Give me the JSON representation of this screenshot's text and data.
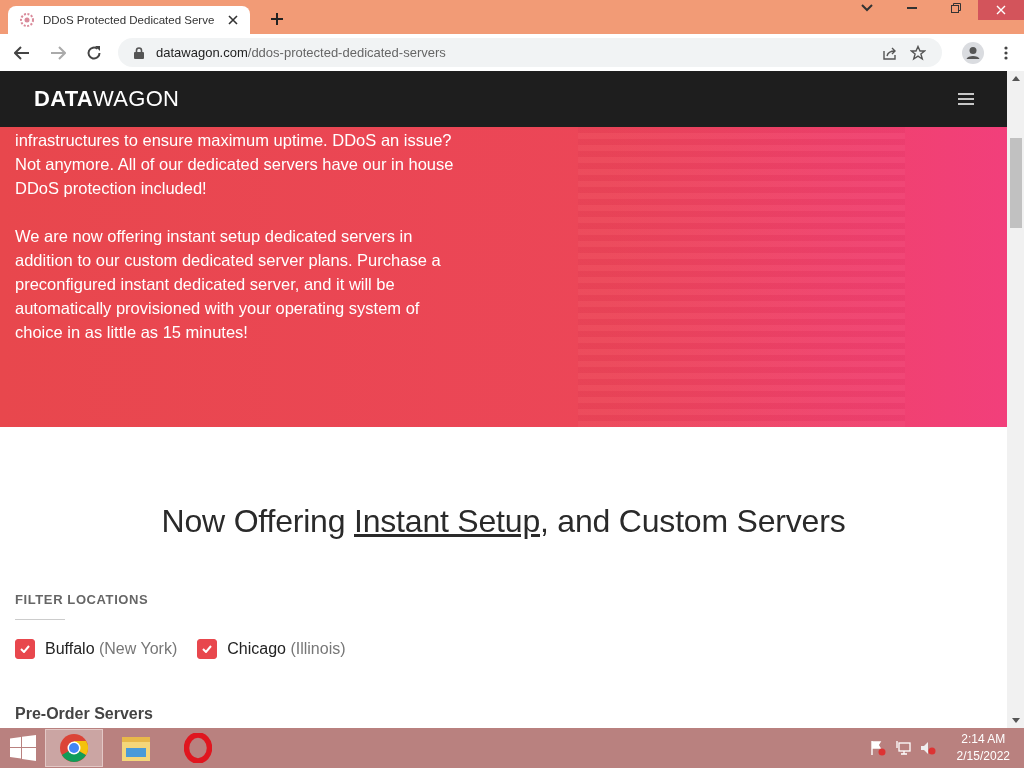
{
  "browser": {
    "tab_title": "DDoS Protected Dedicated Serve",
    "url_host": "datawagon.com",
    "url_path": "/ddos-protected-dedicated-servers"
  },
  "site_nav": {
    "logo_bold": "DATA",
    "logo_light": "WAGON"
  },
  "hero": {
    "paragraphs": [
      "infrastructures to ensure maximum uptime. DDoS an issue? Not anymore. All of our dedicated servers have our in house DDoS protection included!",
      "We are now offering instant setup dedicated servers in addition to our custom dedicated server plans. Purchase a preconfigured instant dedicated server, and it will be automatically provisioned with your operating system of choice in as little as 15 minutes!"
    ]
  },
  "heading": {
    "before": "Now Offering ",
    "link": "Instant Setup",
    "after": ", and Custom Servers"
  },
  "filter": {
    "title": "FILTER LOCATIONS",
    "locations": [
      {
        "city": "Buffalo",
        "region": "(New York)",
        "checked": true
      },
      {
        "city": "Chicago",
        "region": "(Illinois)",
        "checked": true
      }
    ]
  },
  "section_title": "Pre-Order Servers",
  "taskbar": {
    "time": "2:14 AM",
    "date": "2/15/2022",
    "apps": [
      {
        "kind": "chrome",
        "selected": true
      },
      {
        "kind": "explorer",
        "selected": false
      },
      {
        "kind": "opera",
        "selected": false
      }
    ]
  }
}
